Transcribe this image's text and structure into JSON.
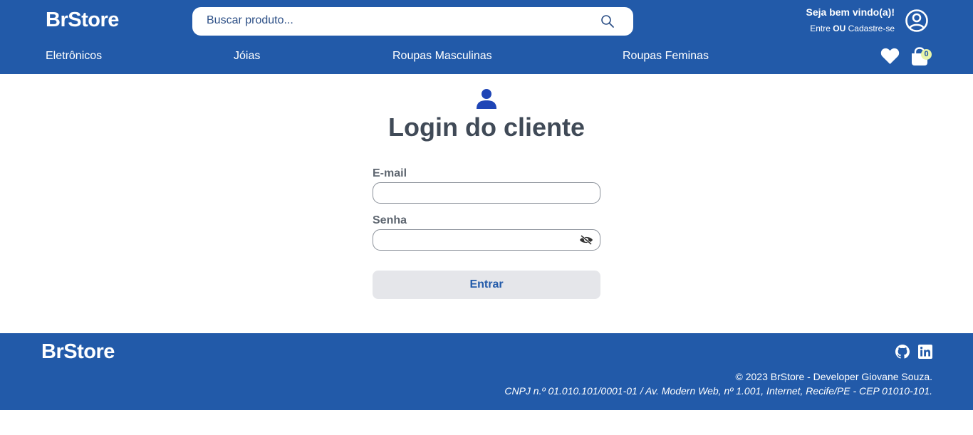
{
  "header": {
    "logo": "BrStore",
    "search_placeholder": "Buscar produto...",
    "welcome_title": "Seja bem vindo(a)!",
    "login_link": "Entre",
    "or_text": "OU",
    "register_link": "Cadastre-se",
    "nav": [
      "Eletrônicos",
      "Jóias",
      "Roupas Masculinas",
      "Roupas Feminas"
    ],
    "cart_count": "0"
  },
  "login": {
    "title": "Login do cliente",
    "email_label": "E-mail",
    "email_value": "",
    "password_label": "Senha",
    "password_value": "",
    "submit_label": "Entrar"
  },
  "footer": {
    "logo": "BrStore",
    "copyright": "© 2023 BrStore - Developer Giovane Souza.",
    "address": "CNPJ n.º 01.010.101/0001-01 / Av. Modern Web, nº 1.001, Internet, Recife/PE - CEP 01010-101."
  },
  "colors": {
    "brand": "#225aa9",
    "button_bg": "#e5e6ea",
    "badge": "#e9f5a9"
  },
  "icons": [
    "search-icon",
    "user-circle-icon",
    "heart-icon",
    "shopping-bag-icon",
    "person-icon",
    "eye-slash-icon",
    "github-icon",
    "linkedin-icon"
  ]
}
